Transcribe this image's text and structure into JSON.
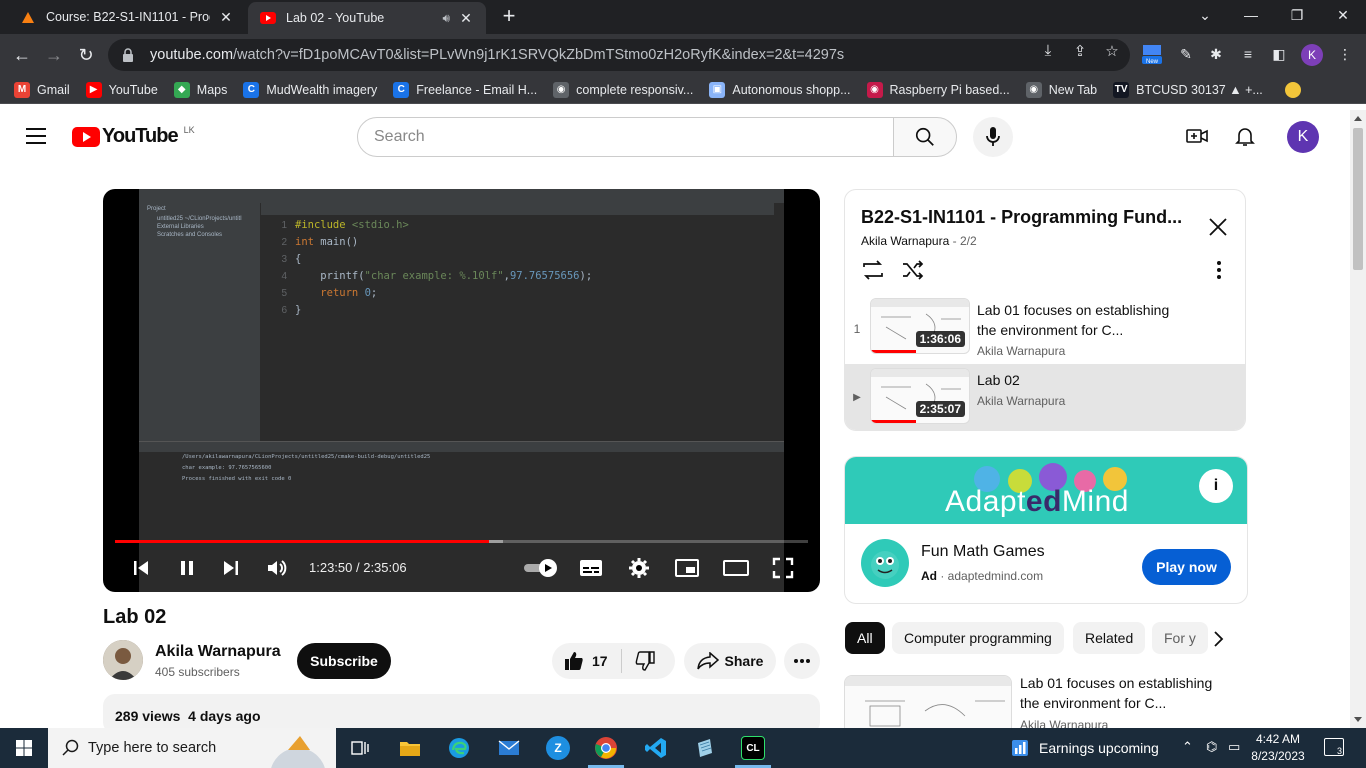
{
  "browser": {
    "tabs": [
      {
        "title": "Course: B22-S1-IN1101 - Program",
        "active": false
      },
      {
        "title": "Lab 02 - YouTube",
        "active": true
      }
    ],
    "new_tab": "+",
    "url_host": "youtube.com",
    "url_rest": "/watch?v=fD1poMCAvT0&list=PLvWn9j1rK1SRVQkZbDmTStmo0zH2oRyfK&index=2&t=4297s",
    "profile_initial": "K",
    "ext_new_badge": "New",
    "bookmarks": [
      {
        "label": "Gmail",
        "icon": "gmail-icon",
        "color": "#ea4335",
        "glyph": "M"
      },
      {
        "label": "YouTube",
        "icon": "youtube-icon",
        "color": "#ff0000",
        "glyph": "▶"
      },
      {
        "label": "Maps",
        "icon": "maps-icon",
        "color": "#34a853",
        "glyph": "◆"
      },
      {
        "label": "MudWealth imagery",
        "icon": "mudwealth-icon",
        "color": "#1a73e8",
        "glyph": "C"
      },
      {
        "label": "Freelance - Email H...",
        "icon": "freelance-icon",
        "color": "#1a73e8",
        "glyph": "C"
      },
      {
        "label": "complete responsiv...",
        "icon": "globe-icon",
        "color": "#5f6368",
        "glyph": "◉"
      },
      {
        "label": "Autonomous shopp...",
        "icon": "image-icon",
        "color": "#8ab4f8",
        "glyph": "▣"
      },
      {
        "label": "Raspberry Pi based...",
        "icon": "raspberry-icon",
        "color": "#c51a4a",
        "glyph": "◉"
      },
      {
        "label": "New Tab",
        "icon": "globe-icon",
        "color": "#5f6368",
        "glyph": "◉"
      },
      {
        "label": "BTCUSD 30137 ▲ +...",
        "icon": "tradingview-icon",
        "color": "#131722",
        "glyph": "TV"
      }
    ]
  },
  "youtube": {
    "logo_text": "YouTube",
    "region": "LK",
    "search_placeholder": "Search",
    "avatar_initial": "K"
  },
  "player": {
    "code_lines": [
      {
        "n": "1",
        "html": "<span class='pp'>#include</span> <span class='st'>&lt;stdio.h&gt;</span>"
      },
      {
        "n": "2",
        "html": "<span class='kw'>int</span> main()"
      },
      {
        "n": "3",
        "html": "{"
      },
      {
        "n": "4",
        "html": "    printf(<span class='st'>\"char example: %.10lf\"</span>,<span class='nm'>97.76575656</span>);"
      },
      {
        "n": "5",
        "html": "    <span class='kw'>return</span> <span class='nm'>0</span>;"
      },
      {
        "n": "6",
        "html": "}"
      }
    ],
    "project_tree": [
      "Project",
      "untitled25  ~/CLionProjects/untitl",
      "External Libraries",
      "Scratches and Consoles"
    ],
    "run_output": [
      "/Users/akilawarnapura/CLionProjects/untitled25/cmake-build-debug/untitled25",
      "char example: 97.7657565600",
      "Process finished with exit code 0"
    ],
    "current_time": "1:23:50",
    "duration": "2:35:06",
    "time_display": "1:23:50 / 2:35:06",
    "progress_played": 0.54,
    "progress_buffered": 0.56
  },
  "video": {
    "title": "Lab 02",
    "channel": "Akila Warnapura",
    "subscribers": "405 subscribers",
    "subscribe_label": "Subscribe",
    "likes": "17",
    "share_label": "Share",
    "views_date": "289 views  4 days ago"
  },
  "playlist": {
    "title": "B22-S1-IN1101 - Programming Fund...",
    "owner": "Akila Warnapura",
    "position": "2/2",
    "items": [
      {
        "index": "1",
        "title": "Lab 01 focuses on establishing the environment for C...",
        "channel": "Akila Warnapura",
        "duration": "1:36:06",
        "watched": 0.45
      },
      {
        "index": "▶",
        "title": "Lab 02",
        "channel": "Akila Warnapura",
        "duration": "2:35:07",
        "watched": 0.45
      }
    ]
  },
  "ad": {
    "brand_pre": "Adapt",
    "brand_mid": "ed",
    "brand_post": "Mind",
    "title": "Fun Math Games",
    "ad_label": "Ad",
    "domain": "adaptedmind.com",
    "cta": "Play now"
  },
  "chips": [
    "All",
    "Computer programming",
    "Related",
    "For y"
  ],
  "related": {
    "title": "Lab 01 focuses on establishing the environment for C...",
    "channel": "Akila Warnapura"
  },
  "taskbar": {
    "search_placeholder": "Type here to search",
    "earnings": "Earnings upcoming",
    "time": "4:42 AM",
    "date": "8/23/2023",
    "notifications": "3"
  }
}
